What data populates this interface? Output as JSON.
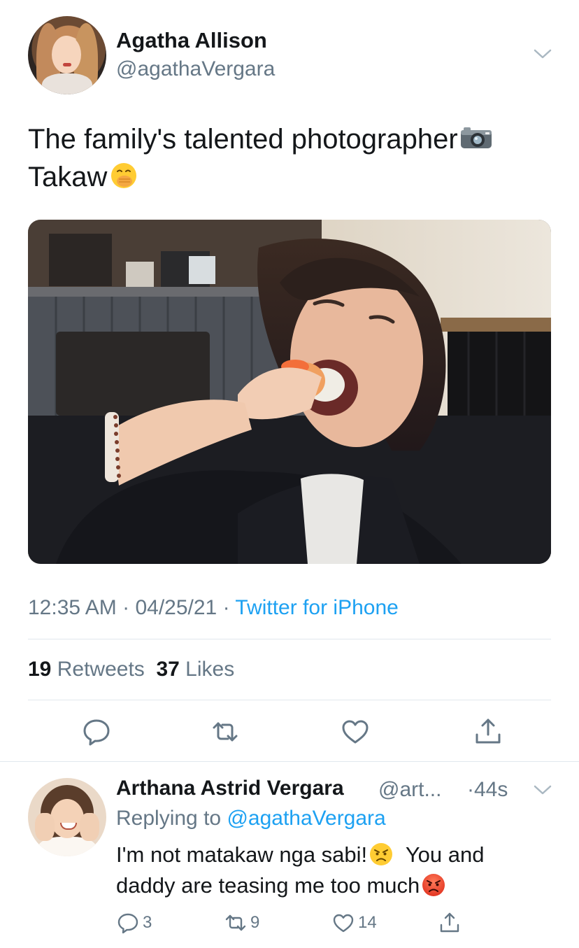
{
  "tweet": {
    "author_name": "Agatha Allison",
    "author_handle": "@agathaVergara",
    "text_line1": "The family's talented photographer",
    "text_line2": "Takaw",
    "emojis": [
      "camera-with-flash",
      "face-with-hand-over-mouth"
    ],
    "time": "12:35 AM",
    "date": "04/25/21",
    "source": "Twitter for iPhone",
    "retweets_count": "19",
    "retweets_label": "Retweets",
    "likes_count": "37",
    "likes_label": "Likes",
    "actions": [
      "reply-icon",
      "retweet-icon",
      "like-icon",
      "share-icon"
    ]
  },
  "reply": {
    "author_name": "Arthana Astrid Vergara",
    "author_handle": "@art...",
    "time": "44s",
    "replying_prefix": "Replying to",
    "replying_to": "@agathaVergara",
    "text_part1": "I'm not matakaw nga sabi!",
    "text_part2": "You and",
    "text_part3": "daddy are teasing me too much",
    "emojis": [
      "pouting-face",
      "angry-face"
    ],
    "reply_count": "3",
    "retweet_count": "9",
    "like_count": "14"
  },
  "colors": {
    "text": "#14171a",
    "secondary": "#657786",
    "accent": "#1da1f2",
    "divider": "#e1e8ed"
  }
}
